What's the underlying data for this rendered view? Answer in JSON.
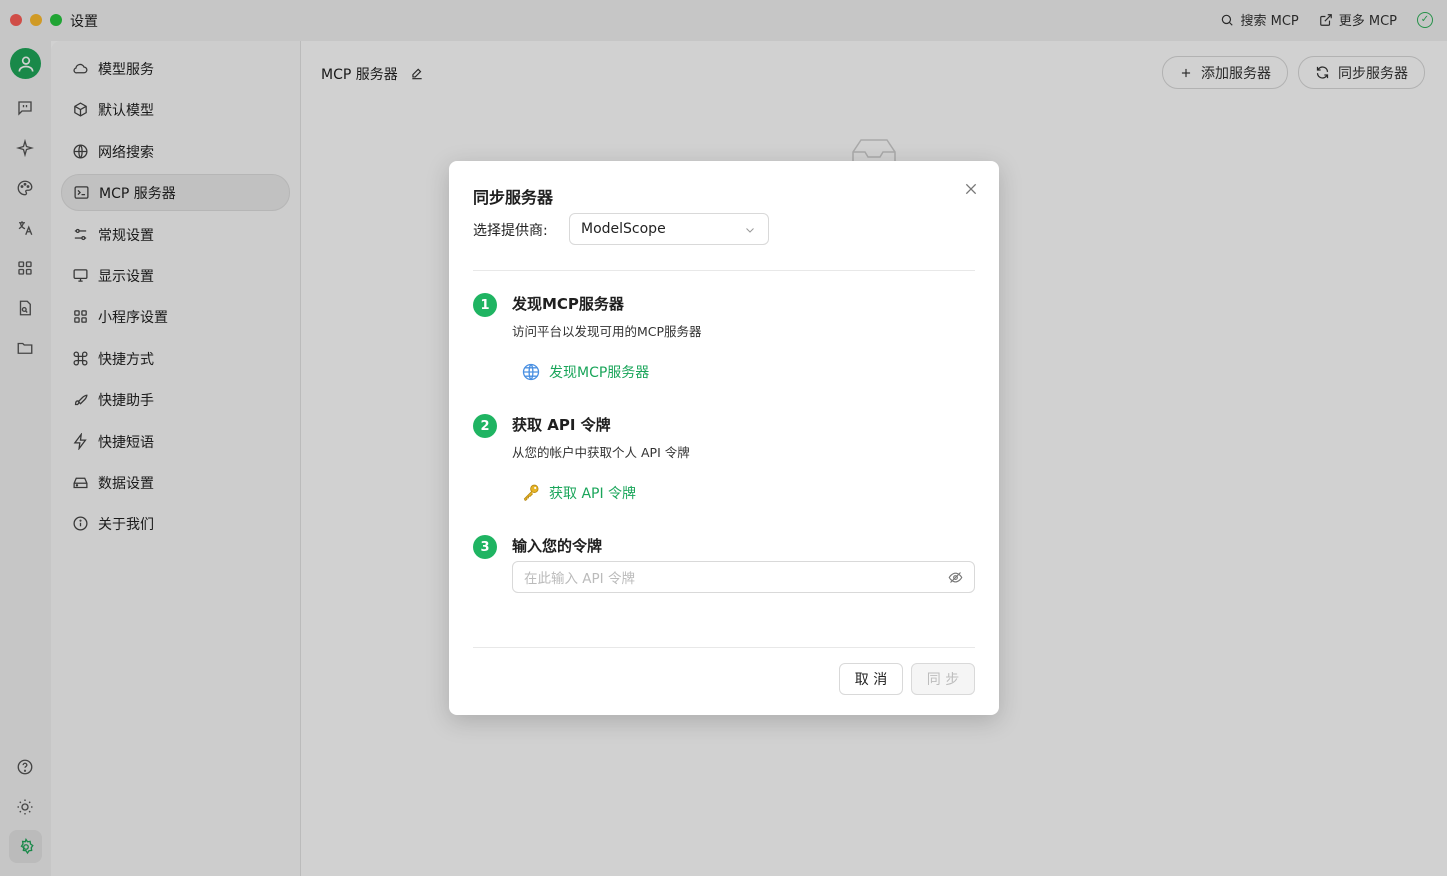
{
  "window": {
    "title": "设置"
  },
  "titlebar": {
    "search_mcp": "搜索 MCP",
    "more_mcp": "更多 MCP"
  },
  "nav": {
    "items": [
      {
        "label": "模型服务",
        "icon": "cloud-icon"
      },
      {
        "label": "默认模型",
        "icon": "cube-icon"
      },
      {
        "label": "网络搜索",
        "icon": "globe-icon"
      },
      {
        "label": "MCP 服务器",
        "icon": "terminal-icon",
        "active": true
      },
      {
        "label": "常规设置",
        "icon": "sliders-icon"
      },
      {
        "label": "显示设置",
        "icon": "monitor-icon"
      },
      {
        "label": "小程序设置",
        "icon": "grid-icon"
      },
      {
        "label": "快捷方式",
        "icon": "command-icon"
      },
      {
        "label": "快捷助手",
        "icon": "rocket-icon"
      },
      {
        "label": "快捷短语",
        "icon": "zap-icon"
      },
      {
        "label": "数据设置",
        "icon": "hard-drive-icon"
      },
      {
        "label": "关于我们",
        "icon": "info-icon"
      }
    ]
  },
  "main": {
    "title": "MCP 服务器",
    "add_server": "添加服务器",
    "sync_server": "同步服务器"
  },
  "modal": {
    "title": "同步服务器",
    "provider_label": "选择提供商:",
    "provider_value": "ModelScope",
    "steps": [
      {
        "num": "1",
        "title": "发现MCP服务器",
        "desc": "访问平台以发现可用的MCP服务器",
        "link": "发现MCP服务器"
      },
      {
        "num": "2",
        "title": "获取 API 令牌",
        "desc": "从您的帐户中获取个人 API 令牌",
        "link": "获取 API 令牌"
      },
      {
        "num": "3",
        "title": "输入您的令牌"
      }
    ],
    "token_placeholder": "在此输入 API 令牌",
    "cancel": "取 消",
    "sync": "同 步"
  },
  "colors": {
    "accent": "#1fb462",
    "link": "#1aa55a",
    "avatar": "#1fa85a"
  }
}
